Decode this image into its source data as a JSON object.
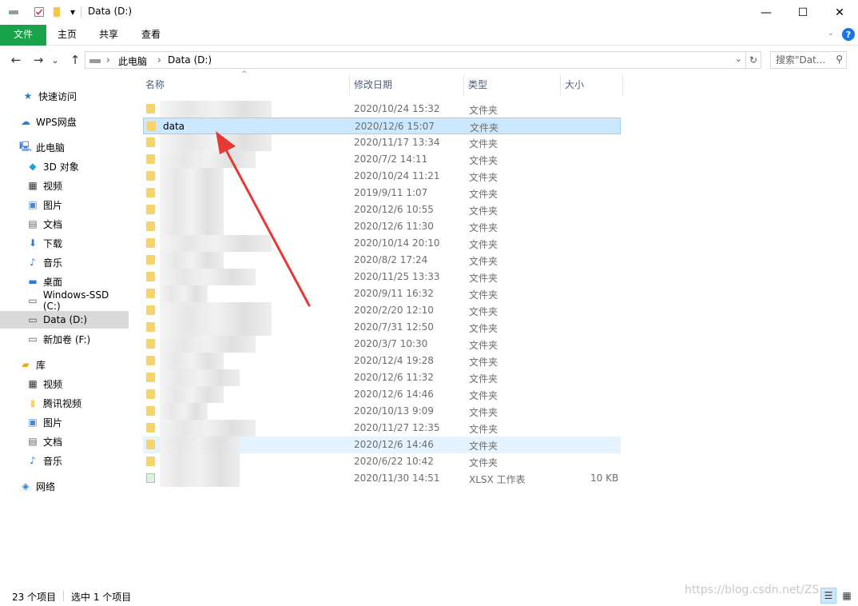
{
  "window": {
    "title": "Data (D:)",
    "quick_access": {
      "drive_icon": "drive-icon",
      "properties_icon": "properties-check-icon",
      "folder_icon": "new-folder-icon",
      "dropdown_glyph": "▾"
    },
    "minimize_glyph": "—",
    "maximize_glyph": "☐",
    "close_glyph": "✕"
  },
  "ribbon": {
    "file_tab": "文件",
    "tabs": [
      "主页",
      "共享",
      "查看"
    ],
    "file_color": "#19a24b",
    "collapse_glyph": "⌄",
    "help_glyph": "?"
  },
  "address": {
    "back_glyph": "←",
    "forward_glyph": "→",
    "recent_glyph": "⌄",
    "up_glyph": "↑",
    "crumb_sep": "›",
    "crumbs": [
      "此电脑",
      "Data (D:)"
    ],
    "dropdown_glyph": "⌄",
    "refresh_glyph": "↻",
    "search_placeholder": "搜索\"Dat...",
    "search_glyph": "⚲"
  },
  "sidebar": {
    "items": [
      {
        "label": "快速访问",
        "icon": "star-icon",
        "glyph": "★",
        "color": "#2b7bd8"
      },
      {
        "label": "WPS网盘",
        "icon": "cloud-icon",
        "glyph": "☁",
        "color": "#2b7bd8"
      },
      {
        "label": "此电脑",
        "icon": "computer-icon",
        "glyph": "🖳",
        "color": "#3a7bd5"
      },
      {
        "label": "3D 对象",
        "icon": "cube-icon",
        "glyph": "◆",
        "color": "#29a0d9"
      },
      {
        "label": "视频",
        "icon": "film-icon",
        "glyph": "▦",
        "color": "#333"
      },
      {
        "label": "图片",
        "icon": "picture-icon",
        "glyph": "▣",
        "color": "#4a86c8"
      },
      {
        "label": "文档",
        "icon": "document-icon",
        "glyph": "▤",
        "color": "#666"
      },
      {
        "label": "下载",
        "icon": "download-icon",
        "glyph": "⬇",
        "color": "#2b7bd8"
      },
      {
        "label": "音乐",
        "icon": "music-icon",
        "glyph": "♪",
        "color": "#2b7bd8"
      },
      {
        "label": "桌面",
        "icon": "desktop-icon",
        "glyph": "▬",
        "color": "#2b7bd8"
      },
      {
        "label": "Windows-SSD (C:)",
        "icon": "windows-drive-icon",
        "glyph": "▭",
        "color": "#555"
      },
      {
        "label": "Data (D:)",
        "icon": "drive-icon",
        "glyph": "▭",
        "color": "#555"
      },
      {
        "label": "新加卷 (F:)",
        "icon": "drive-icon",
        "glyph": "▭",
        "color": "#555"
      },
      {
        "label": "库",
        "icon": "library-icon",
        "glyph": "▰",
        "color": "#e8a820"
      },
      {
        "label": "视频",
        "icon": "film-icon",
        "glyph": "▦",
        "color": "#333"
      },
      {
        "label": "腾讯视频",
        "icon": "folder-icon",
        "glyph": "▮",
        "color": "#f6d36b"
      },
      {
        "label": "图片",
        "icon": "picture-icon",
        "glyph": "▣",
        "color": "#4a86c8"
      },
      {
        "label": "文档",
        "icon": "document-icon",
        "glyph": "▤",
        "color": "#666"
      },
      {
        "label": "音乐",
        "icon": "music-icon",
        "glyph": "♪",
        "color": "#2b7bd8"
      },
      {
        "label": "网络",
        "icon": "network-icon",
        "glyph": "◈",
        "color": "#2b7bd8"
      }
    ]
  },
  "columns": {
    "name": "名称",
    "date": "修改日期",
    "type": "类型",
    "size": "大小",
    "sort_glyph": "^"
  },
  "files": [
    {
      "name": "",
      "date": "2020/10/24 15:32",
      "type": "文件夹",
      "size": ""
    },
    {
      "name": "data",
      "date": "2020/12/6 15:07",
      "type": "文件夹",
      "size": ""
    },
    {
      "name": "",
      "date": "2020/11/17 13:34",
      "type": "文件夹",
      "size": ""
    },
    {
      "name": "",
      "date": "2020/7/2 14:11",
      "type": "文件夹",
      "size": ""
    },
    {
      "name": "",
      "date": "2020/10/24 11:21",
      "type": "文件夹",
      "size": ""
    },
    {
      "name": "",
      "date": "2019/9/11 1:07",
      "type": "文件夹",
      "size": ""
    },
    {
      "name": "",
      "date": "2020/12/6 10:55",
      "type": "文件夹",
      "size": ""
    },
    {
      "name": "",
      "date": "2020/12/6 11:30",
      "type": "文件夹",
      "size": ""
    },
    {
      "name": "",
      "date": "2020/10/14 20:10",
      "type": "文件夹",
      "size": ""
    },
    {
      "name": "",
      "date": "2020/8/2 17:24",
      "type": "文件夹",
      "size": ""
    },
    {
      "name": "",
      "date": "2020/11/25 13:33",
      "type": "文件夹",
      "size": ""
    },
    {
      "name": "",
      "date": "2020/9/11 16:32",
      "type": "文件夹",
      "size": ""
    },
    {
      "name": "",
      "date": "2020/2/20 12:10",
      "type": "文件夹",
      "size": ""
    },
    {
      "name": "",
      "date": "2020/7/31 12:50",
      "type": "文件夹",
      "size": ""
    },
    {
      "name": "",
      "date": "2020/3/7 10:30",
      "type": "文件夹",
      "size": ""
    },
    {
      "name": "",
      "date": "2020/12/4 19:28",
      "type": "文件夹",
      "size": ""
    },
    {
      "name": "",
      "date": "2020/12/6 11:32",
      "type": "文件夹",
      "size": ""
    },
    {
      "name": "",
      "date": "2020/12/6 14:46",
      "type": "文件夹",
      "size": ""
    },
    {
      "name": "",
      "date": "2020/10/13 9:09",
      "type": "文件夹",
      "size": ""
    },
    {
      "name": "",
      "date": "2020/11/27 12:35",
      "type": "文件夹",
      "size": ""
    },
    {
      "name": "",
      "date": "2020/12/6 14:46",
      "type": "文件夹",
      "size": ""
    },
    {
      "name": "",
      "date": "2020/6/22 10:42",
      "type": "文件夹",
      "size": ""
    },
    {
      "name": "",
      "date": "2020/11/30 14:51",
      "type": "XLSX 工作表",
      "size": "10 KB"
    }
  ],
  "status": {
    "count": "23 个项目",
    "selection": "选中 1 个项目",
    "details_view_glyph": "☰",
    "tiles_view_glyph": "▦"
  },
  "watermark": "https://blog.csdn.net/ZS",
  "colors": {
    "selection_fill": "#cce8ff",
    "selection_border": "#99d1ff",
    "hover_fill": "#e5f3ff",
    "arrow": "#e53935"
  }
}
